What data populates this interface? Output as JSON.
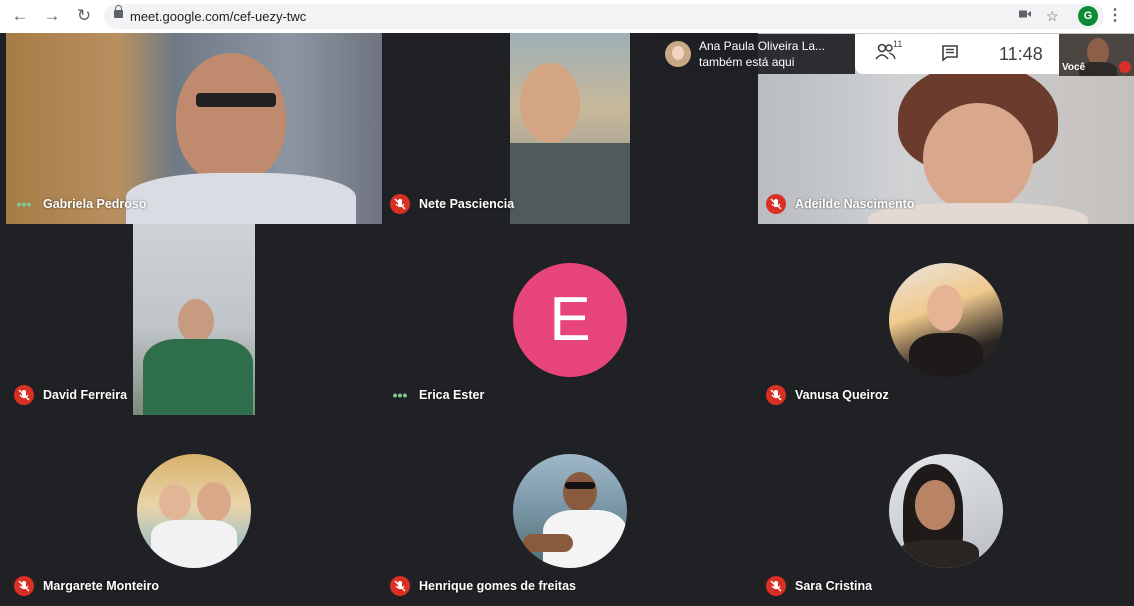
{
  "browser": {
    "url": "meet.google.com/cef-uezy-twc",
    "profile_initial": "G"
  },
  "notification": {
    "name": "Ana Paula Oliveira La...",
    "message": "também está aqui"
  },
  "toolbar": {
    "people_count": "11",
    "clock": "11:48"
  },
  "self_view": {
    "label": "Você"
  },
  "participants": [
    {
      "name": "Gabriela Pedroso",
      "muted": false
    },
    {
      "name": "Nete Pasciencia",
      "muted": true
    },
    {
      "name": "Adeilde Nascimento",
      "muted": true
    },
    {
      "name": "David Ferreira",
      "muted": true
    },
    {
      "name": "Erica Ester",
      "muted": false,
      "avatar_letter": "E"
    },
    {
      "name": "Vanusa Queiroz",
      "muted": true
    },
    {
      "name": "Margarete Monteiro",
      "muted": true
    },
    {
      "name": "Henrique gomes de freitas",
      "muted": true
    },
    {
      "name": "Sara Cristina",
      "muted": true
    }
  ],
  "colors": {
    "background": "#202124",
    "muted_icon": "#d93025",
    "speaking_icon": "#81c995",
    "letter_avatar": "#e8457a"
  },
  "icons": {
    "back": "arrow-left-icon",
    "forward": "arrow-right-icon",
    "reload": "reload-icon",
    "camera": "camera-icon",
    "star": "star-icon",
    "menu": "more-vert-icon",
    "people": "people-icon",
    "chat": "chat-icon",
    "mic_off": "mic-off-icon"
  }
}
